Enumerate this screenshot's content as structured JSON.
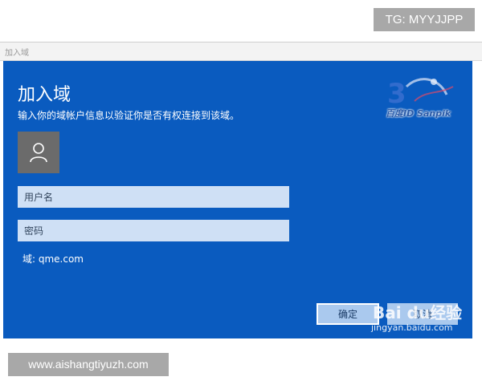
{
  "watermarks": {
    "tg": "TG: MYYJJPP",
    "site": "www.aishangtiyuzh.com",
    "baidu_logo_text": "百度ID Sanpik",
    "jingyan_logo": "Bai du经验",
    "jingyan_url": "jingyan.baidu.com"
  },
  "window": {
    "title": "加入域"
  },
  "dialog": {
    "title": "加入域",
    "description": "输入你的域帐户信息以验证你是否有权连接到该域。",
    "avatar_icon": "user-icon",
    "username_placeholder": "用户名",
    "password_placeholder": "密码",
    "domain_label": "域: qme.com",
    "confirm_label": "确定",
    "cancel_label": "取消"
  },
  "colors": {
    "dialog_background": "#0a5bbf",
    "field_background": "#cfe0f5",
    "button_background": "#aac9ee",
    "avatar_background": "#6b6b6b"
  }
}
